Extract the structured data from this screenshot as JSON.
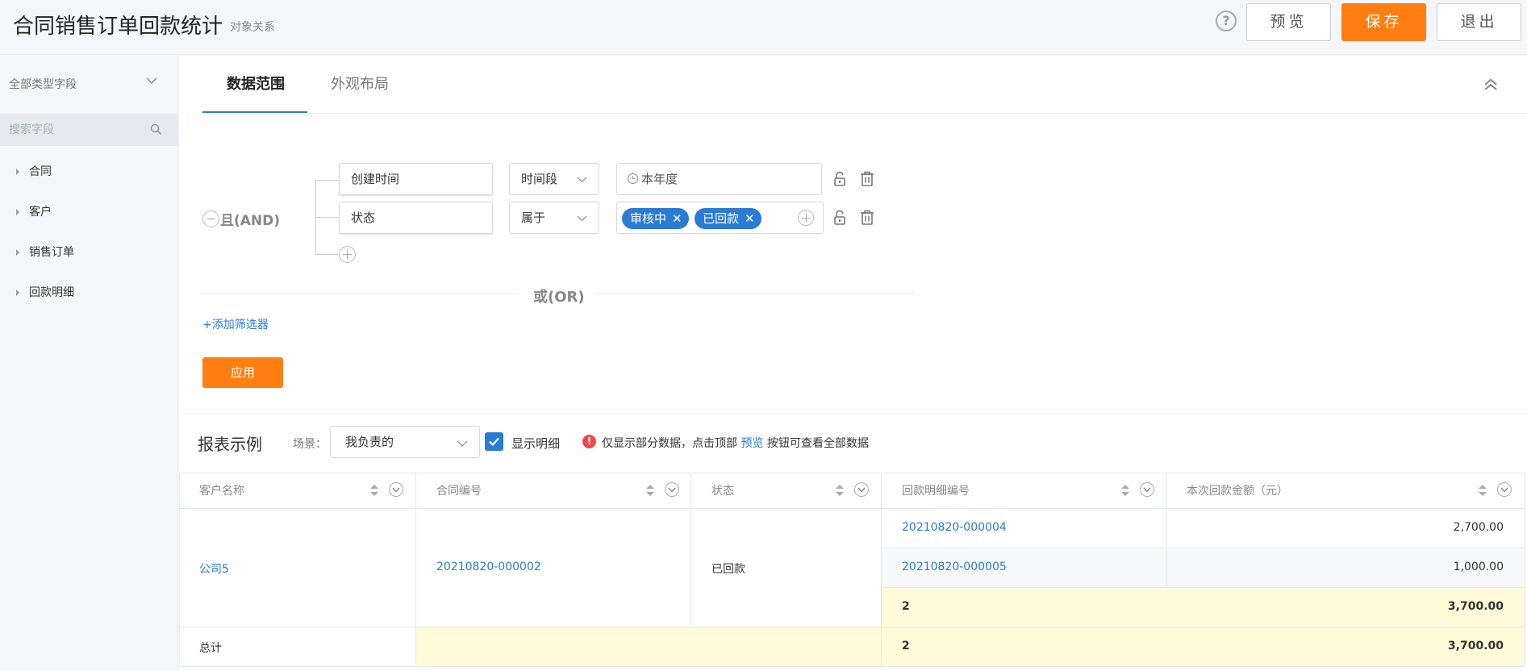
{
  "header": {
    "title": "合同销售订单回款统计",
    "subtitle": "对象关系",
    "help_icon": "?",
    "preview_label": "预览",
    "save_label": "保存",
    "exit_label": "退出"
  },
  "sidebar": {
    "field_type_select": "全部类型字段",
    "search_placeholder": "搜索字段",
    "items": [
      {
        "label": "合同"
      },
      {
        "label": "客户"
      },
      {
        "label": "销售订单"
      },
      {
        "label": "回款明细"
      }
    ]
  },
  "tabs": [
    {
      "label": "数据范围",
      "active": true
    },
    {
      "label": "外观布局",
      "active": false
    }
  ],
  "filters": {
    "group_label": "且(AND)",
    "conditions": [
      {
        "field": "创建时间",
        "operator": "时间段",
        "value": "本年度"
      },
      {
        "field": "状态",
        "operator": "属于",
        "tags": [
          "审核中",
          "已回款"
        ]
      }
    ],
    "or_label": "或(OR)",
    "add_filter_label": "+添加筛选器",
    "apply_label": "应用"
  },
  "report": {
    "title": "报表示例",
    "scene_label": "场景：",
    "scene_value": "我负责的",
    "show_detail_label": "显示明细",
    "notice_prefix": "仅显示部分数据，点击顶部",
    "notice_link": "预览",
    "notice_suffix": "按钮可查看全部数据",
    "columns": [
      "客户名称",
      "合同编号",
      "状态",
      "回款明细编号",
      "本次回款金额（元）"
    ],
    "row": {
      "customer": "公司5",
      "contract": "20210820-000002",
      "status": "已回款",
      "details": [
        {
          "id": "20210820-000004",
          "amount": "2,700.00"
        },
        {
          "id": "20210820-000005",
          "amount": "1,000.00"
        }
      ],
      "subtotal_count": "2",
      "subtotal_amount": "3,700.00"
    },
    "total": {
      "label": "总计",
      "count": "2",
      "amount": "3,700.00"
    }
  },
  "colors": {
    "accent": "#2a7bd4",
    "primary_button": "#ff7e12",
    "subtotal_bg": "#fffbd9"
  }
}
